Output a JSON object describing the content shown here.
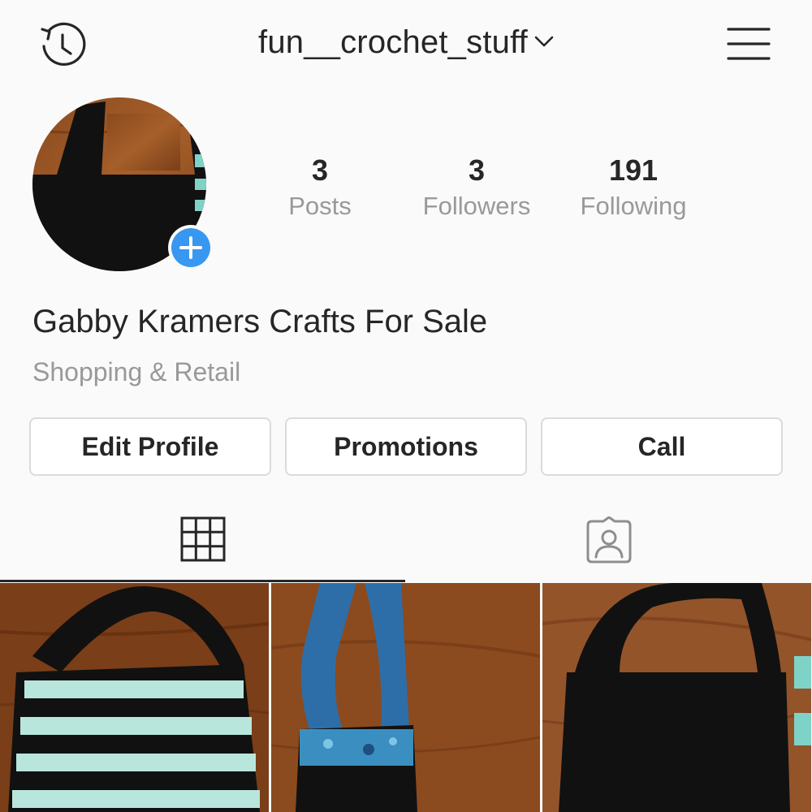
{
  "header": {
    "username": "fun__crochet_stuff",
    "icons": {
      "left": "history-icon",
      "dropdown": "chevron-down-icon",
      "right": "hamburger-menu-icon"
    }
  },
  "profile": {
    "avatar": "avatar-photo",
    "add_story_icon": "plus-icon",
    "stats": [
      {
        "value": "3",
        "label": "Posts"
      },
      {
        "value": "3",
        "label": "Followers"
      },
      {
        "value": "191",
        "label": "Following"
      }
    ],
    "display_name": "Gabby Kramers Crafts For Sale",
    "category": "Shopping & Retail"
  },
  "actions": {
    "edit_profile": "Edit Profile",
    "promotions": "Promotions",
    "call": "Call"
  },
  "tabs": {
    "grid_icon": "grid-icon",
    "tagged_icon": "tagged-person-icon",
    "active": "grid"
  },
  "posts": [
    {
      "subject": "black and mint striped crochet bag"
    },
    {
      "subject": "blue variegated crochet bag"
    },
    {
      "subject": "black crochet bag"
    }
  ],
  "colors": {
    "accent": "#3897f0",
    "text": "#262626",
    "secondary_text": "#999999",
    "border": "#dbdbdb",
    "background": "#fafafa"
  }
}
